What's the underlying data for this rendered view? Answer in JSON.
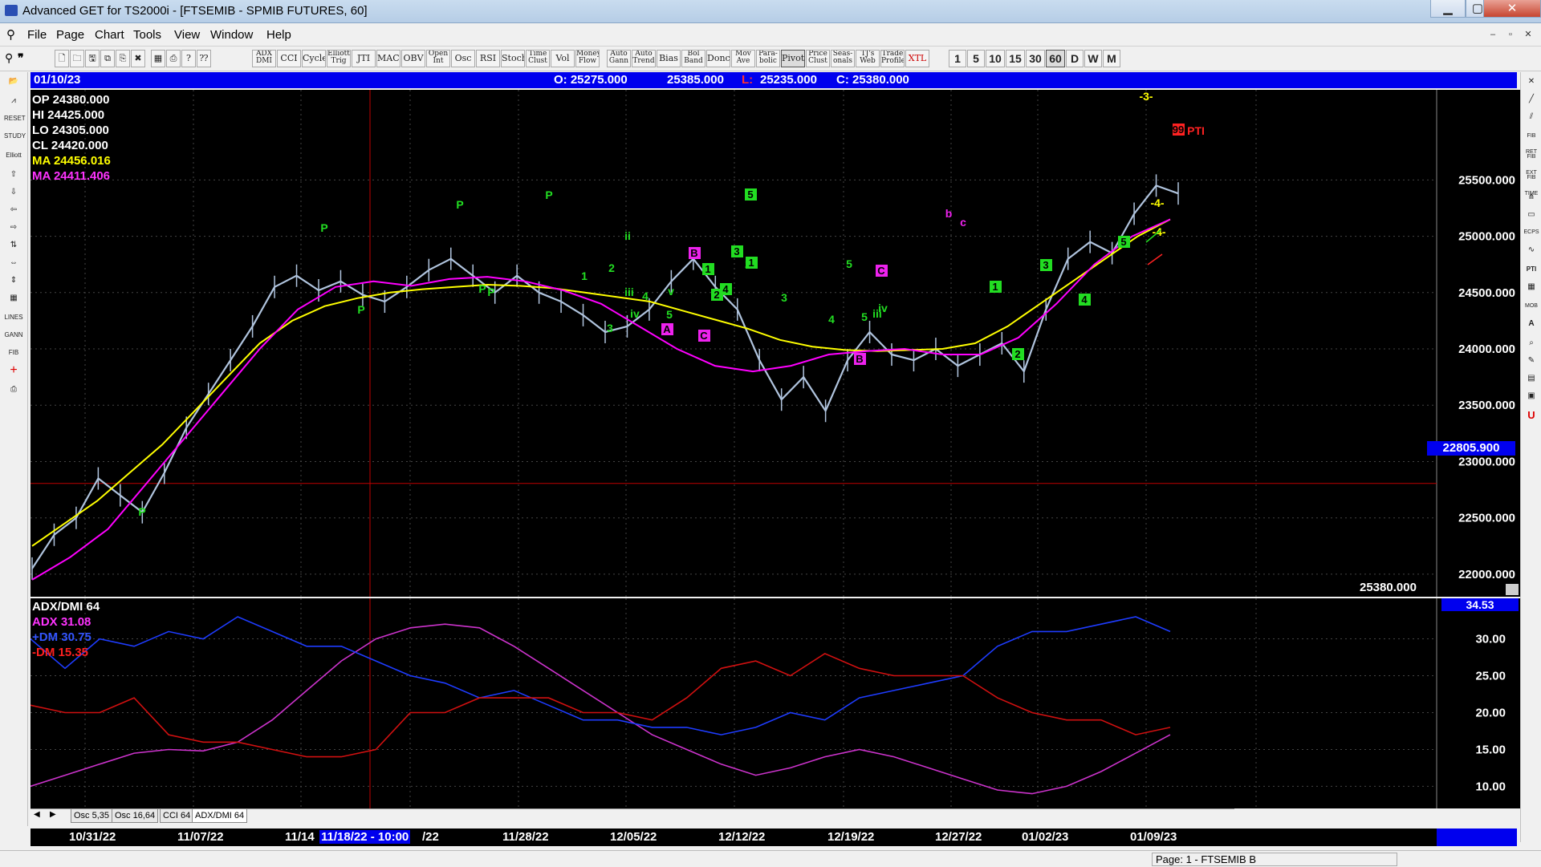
{
  "window": {
    "title": "Advanced GET for TS2000i - [FTSEMIB - SPMIB FUTURES, 60]",
    "minimize": "▁",
    "maximize": "▢",
    "close": "✕"
  },
  "menu": {
    "items": [
      "File",
      "Page",
      "Chart",
      "Tools",
      "View",
      "Window",
      "Help"
    ],
    "mdi": [
      "–",
      "▫",
      "✕"
    ]
  },
  "toolbar": {
    "studies": [
      "ADX DMI",
      "CCI",
      "Cycles",
      "Elliott Trig",
      "JTI",
      "MACD",
      "OBV",
      "Open Int",
      "Osc",
      "RSI",
      "Stoch",
      "Time Clust",
      "Vol",
      "Money Flow",
      "Auto Gann",
      "Auto Trend",
      "Bias",
      "Bol Band",
      "Donch",
      "Mov Ave",
      "Para- bolic",
      "Pivot",
      "Price Clust",
      "Seas- onals",
      "TJ's Web",
      "Trade Profile",
      "XTL"
    ],
    "intervals": [
      "1",
      "5",
      "10",
      "15",
      "30",
      "60",
      "D",
      "W",
      "M"
    ],
    "selected_interval": "60"
  },
  "infobar": {
    "date": "01/10/23",
    "open": "O: 25275.000",
    "high": "25385.000",
    "low_prefix": "L:",
    "low": "25235.000",
    "close": "C: 25380.000"
  },
  "ohlc_panel": {
    "op": "OP  24380.000",
    "hi": "HI   24425.000",
    "lo": "LO  24305.000",
    "cl": "CL  24420.000",
    "ma1": "MA  24456.016",
    "ma2": "MA  24411.406"
  },
  "chart_data": {
    "type": "line",
    "title": "FTSEMIB - SPMIB FUTURES, 60",
    "y_axis_ticks": [
      "25500.000",
      "25000.000",
      "24500.000",
      "24000.000",
      "23500.000",
      "23000.000",
      "22500.000",
      "22000.000"
    ],
    "ylim": [
      21800,
      26300
    ],
    "cursor_price": "22805.900",
    "last_price_label": "25380.000",
    "x_ticks": [
      "10/31/22",
      "11/07/22",
      "11/14",
      "11/18/22 - 10:00",
      "/22",
      "11/28/22",
      "12/05/22",
      "12/12/22",
      "12/19/22",
      "12/27/22",
      "01/02/23",
      "01/09/23"
    ],
    "series": [
      {
        "name": "Price",
        "color": "#b0c4de",
        "values": [
          22050,
          22350,
          22500,
          22850,
          22700,
          22550,
          22900,
          23300,
          23600,
          23900,
          24200,
          24550,
          24650,
          24520,
          24600,
          24480,
          24420,
          24550,
          24700,
          24800,
          24650,
          24500,
          24650,
          24500,
          24420,
          24300,
          24150,
          24200,
          24350,
          24600,
          24800,
          24550,
          24350,
          23900,
          23550,
          23750,
          23450,
          23900,
          24150,
          23950,
          23900,
          24000,
          23850,
          23950,
          24050,
          23800,
          24350,
          24800,
          24950,
          24850,
          25200,
          25450,
          25380
        ]
      },
      {
        "name": "MA",
        "color": "#ffff00",
        "values": [
          22250,
          22450,
          22650,
          22900,
          23150,
          23450,
          23750,
          24050,
          24250,
          24380,
          24450,
          24500,
          24530,
          24550,
          24570,
          24560,
          24540,
          24500,
          24460,
          24420,
          24340,
          24260,
          24180,
          24080,
          24020,
          23990,
          23980,
          23990,
          24000,
          24050,
          24200,
          24400,
          24600,
          24800,
          25000,
          25150
        ]
      },
      {
        "name": "MA",
        "color": "#ff00ff",
        "values": [
          21950,
          22150,
          22400,
          22800,
          23200,
          23600,
          24000,
          24350,
          24550,
          24600,
          24560,
          24620,
          24640,
          24600,
          24520,
          24400,
          24200,
          24000,
          23850,
          23800,
          23850,
          23950,
          23980,
          24000,
          23950,
          23950,
          24100,
          24400,
          24750,
          25000,
          25150
        ]
      }
    ],
    "wave_labels": [
      "P",
      "P",
      "P",
      "P",
      "P",
      "P",
      "P",
      "1",
      "2",
      "ii",
      "iii",
      "iv",
      "v",
      "3",
      "4",
      "5",
      "A",
      "B",
      "C",
      "1",
      "2",
      "3",
      "4",
      "5",
      "1",
      "2",
      "3",
      "4",
      "5",
      "B",
      "C",
      "iii",
      "iv",
      "5",
      "1",
      "2",
      "3",
      "4",
      "5",
      "b",
      "c",
      "-3-",
      "-4-",
      "-4-",
      "99",
      "PTI"
    ]
  },
  "indicator": {
    "name": "ADX/DMI 64",
    "adx": "ADX 31.08",
    "pdm": "+DM 30.75",
    "mdm": "-DM  15.35",
    "current": "34.53",
    "y_ticks": [
      "30.00",
      "25.00",
      "20.00",
      "15.00",
      "10.00"
    ],
    "ylim": [
      7,
      35.5
    ],
    "series": [
      {
        "name": "ADX",
        "color": "#cc33cc",
        "values": [
          10,
          11.5,
          13,
          14.5,
          15,
          14.8,
          16,
          19,
          23,
          27,
          30,
          31.5,
          32,
          31.5,
          29,
          26,
          23,
          20,
          17,
          15,
          13,
          11.5,
          12.5,
          14,
          15,
          14,
          12.5,
          11,
          9.5,
          9,
          10,
          12,
          14.5,
          17
        ]
      },
      {
        "name": "+DM",
        "color": "#1e3cff",
        "values": [
          30,
          26,
          30,
          29,
          31,
          30,
          33,
          31,
          29,
          29,
          27,
          25,
          24,
          22,
          23,
          21,
          19,
          19,
          18,
          18,
          17,
          18,
          20,
          19,
          22,
          23,
          24,
          25,
          29,
          31,
          31,
          32,
          33,
          31
        ]
      },
      {
        "name": "-DM",
        "color": "#d01010",
        "values": [
          21,
          20,
          20,
          22,
          17,
          16,
          16,
          15,
          14,
          14,
          15,
          20,
          20,
          22,
          22,
          22,
          20,
          20,
          19,
          22,
          26,
          27,
          25,
          28,
          26,
          25,
          25,
          25,
          22,
          20,
          19,
          19,
          17,
          18
        ]
      }
    ]
  },
  "tabs": {
    "items": [
      "Osc 5,35",
      "Osc 16,64",
      "CCI 64",
      "ADX/DMI 64"
    ],
    "active": "ADX/DMI 64"
  },
  "status": {
    "page": "Page: 1 - FTSEMIB B"
  },
  "colors": {
    "info_bg": "#0000ee",
    "chart_bg": "#000000",
    "wave_green": "#22dd22",
    "wave_magenta": "#dd22dd",
    "ma_yellow": "#ffff00",
    "ma_magenta": "#ff00ff"
  }
}
